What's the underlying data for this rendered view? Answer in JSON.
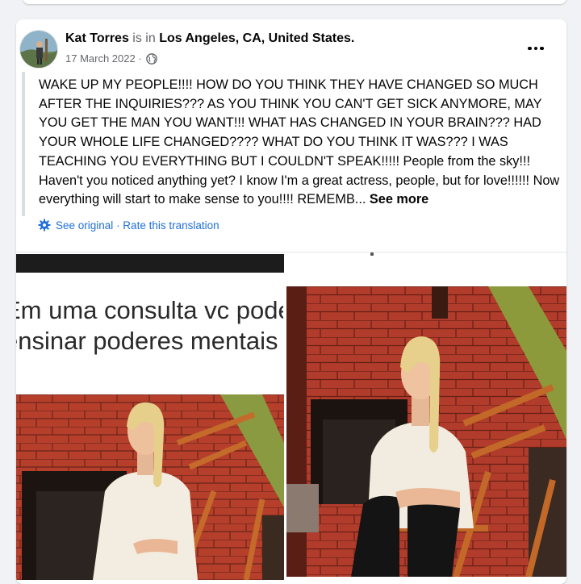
{
  "post": {
    "author": "Kat Torres",
    "is_in": "is in",
    "place": "Los Angeles, CA, United States.",
    "date": "17 March 2022 ·",
    "privacy_icon": "globe-icon",
    "more_icon": "more-horizontal-icon",
    "body": "WAKE UP MY PEOPLE!!!! HOW DO YOU THINK THEY HAVE CHANGED SO MUCH AFTER THE INQUIRIES??? AS YOU THINK YOU CAN'T GET SICK ANYMORE, MAY YOU GET THE MAN YOU WANT!!! WHAT HAS CHANGED IN YOUR BRAIN??? HAD YOUR WHOLE LIFE CHANGED???? WHAT DO YOU THINK IT WAS??? I WAS TEACHING YOU EVERYTHING BUT I COULDN'T SPEAK!!!!! People from the sky!!! Haven't you noticed anything yet? I know I'm a great actress, people, but for love!!!!!! Now everything will start to make sense to you!!!! REMEMB...",
    "see_more": "See more",
    "see_original": "See original",
    "rate_translation": "· Rate this translation",
    "translate_icon": "gear-icon"
  },
  "media": {
    "caption_line1": "Em uma consulta vc pode",
    "caption_line2": "ensinar poderes mentais"
  },
  "colors": {
    "link_blue": "#216fdb",
    "muted": "#65676b",
    "background": "#f0f2f5",
    "brick": "#b03b2a"
  }
}
